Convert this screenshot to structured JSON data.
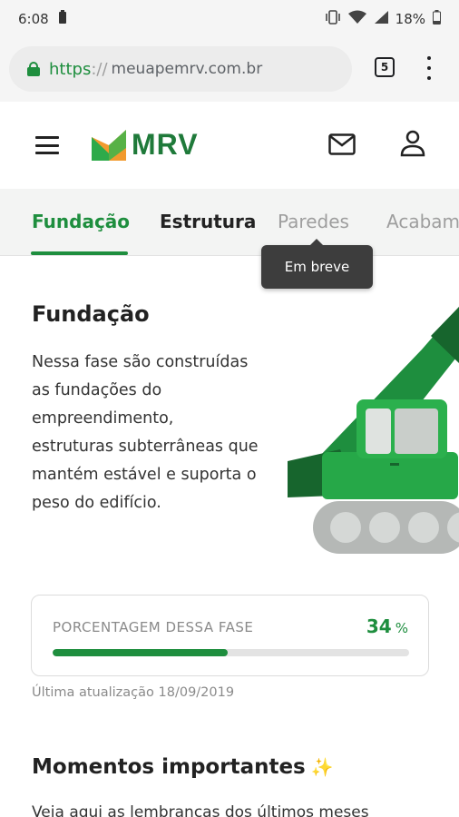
{
  "status_bar": {
    "time": "6:08",
    "battery_percent": "18%"
  },
  "browser": {
    "url_scheme": "https",
    "url_separator": "://",
    "url_host": "meuapemrv.com.br",
    "tab_count": "5"
  },
  "header": {
    "logo_text": "MRV"
  },
  "tabs": [
    {
      "label": "Fundação",
      "active": true
    },
    {
      "label": "Estrutura",
      "active": false
    },
    {
      "label": "Paredes",
      "active": false
    },
    {
      "label": "Acabam",
      "active": false
    }
  ],
  "tooltip": {
    "text": "Em breve"
  },
  "phase": {
    "title": "Fundação",
    "description": "Nessa fase são construídas as fundações do empreendimento, estruturas subterrâneas que mantém estável e suporta o peso do edifício."
  },
  "progress": {
    "label": "PORCENTAGEM DESSA FASE",
    "value": "34",
    "unit": "%",
    "fraction": 0.49
  },
  "last_update": "Última atualização 18/09/2019",
  "moments": {
    "title": "Momentos importantes",
    "sparkle": "✨",
    "description": "Veja aqui as lembranças dos últimos meses"
  },
  "colors": {
    "brand_green": "#1e8e3e",
    "logo_orange": "#f29a2e",
    "tooltip_bg": "#3d3d3d"
  }
}
